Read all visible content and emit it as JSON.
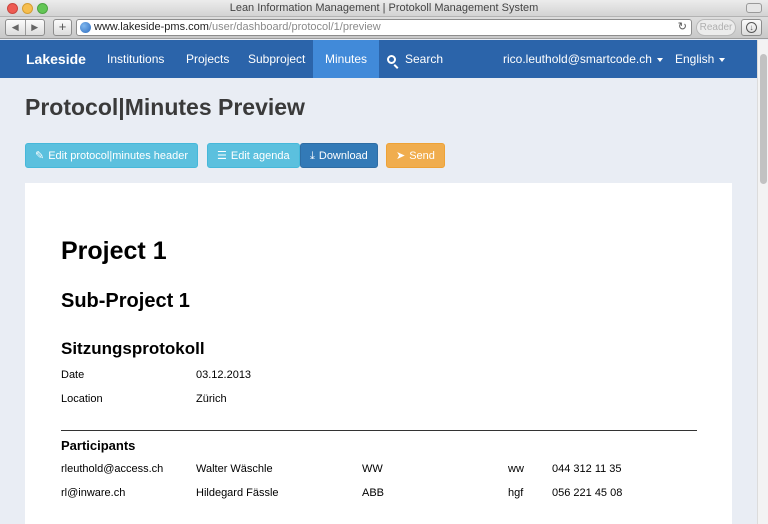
{
  "window": {
    "title": "Lean Information Management | Protokoll Management System"
  },
  "browser": {
    "url_domain": "www.lakeside-pms.com",
    "url_path": "/user/dashboard/protocol/1/preview",
    "reader_label": "Reader",
    "back_glyph": "◀",
    "forward_glyph": "▶",
    "new_tab_glyph": "+",
    "reload_glyph": "↻",
    "download_glyph": "↓"
  },
  "navbar": {
    "brand": "Lakeside",
    "links": [
      "Institutions",
      "Projects",
      "Subproject",
      "Minutes",
      "Search"
    ],
    "active": "Minutes",
    "user": "rico.leuthold@smartcode.ch",
    "language": "English",
    "colors": {
      "bar": "#2b64aa",
      "active": "#418ad9"
    }
  },
  "page": {
    "title": "Protocol|Minutes Preview",
    "buttons": {
      "edit_header": "Edit protocol|minutes header",
      "edit_agenda": "Edit agenda",
      "download": "Download",
      "send": "Send"
    },
    "icons": {
      "edit_header": "✎",
      "edit_agenda": "☰",
      "download": "⤓",
      "send": "➤"
    }
  },
  "document": {
    "project": "Project 1",
    "subproject": "Sub-Project 1",
    "protocol_type": "Sitzungsprotokoll",
    "meta": [
      {
        "label": "Date",
        "value": "03.12.2013"
      },
      {
        "label": "Location",
        "value": "Zürich"
      }
    ],
    "participants_heading": "Participants",
    "participants": [
      {
        "email": "rleuthold@access.ch",
        "name": "Walter Wäschle",
        "org": "WW",
        "short": "ww",
        "phone": "044 312 11 35"
      },
      {
        "email": "rl@inware.ch",
        "name": "Hildegard Fässle",
        "org": "ABB",
        "short": "hgf",
        "phone": "056 221 45 08"
      }
    ]
  }
}
